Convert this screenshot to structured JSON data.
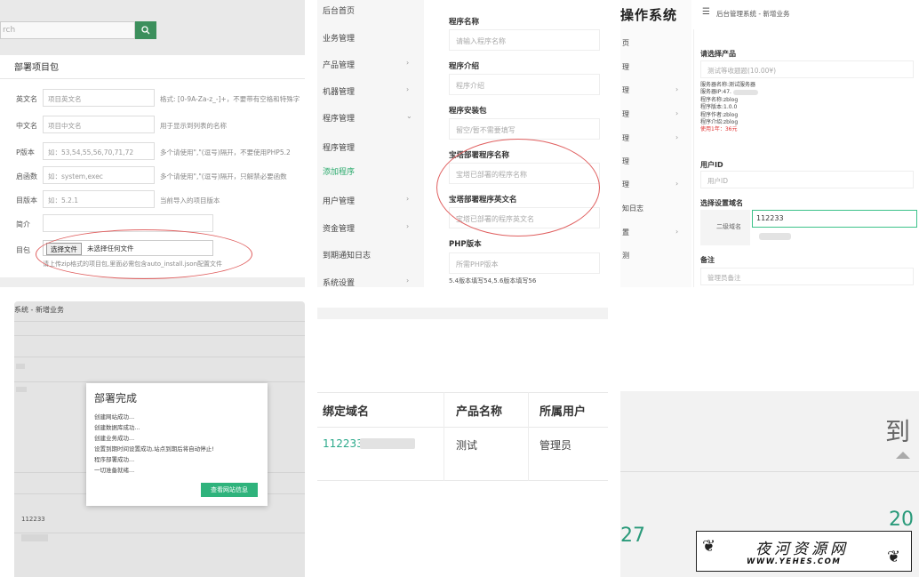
{
  "panel1": {
    "search_placeholder": "rch",
    "search_icon": "search-icon",
    "page_title": "部署项目包",
    "rows": [
      {
        "label": "英文名",
        "value": "项目英文名",
        "hint": "格式: [0-9A-Za-z_-]+，不要带有空格和特殊字"
      },
      {
        "label": "中文名",
        "value": "项目中文名",
        "hint": "用于显示到列表的名称"
      },
      {
        "label": "P版本",
        "value": "如：53,54,55,56,70,71,72",
        "hint": "多个请使用\",\"(逗号)隔开，不要使用PHP5.2"
      },
      {
        "label": "启函数",
        "value": "如：system,exec",
        "hint": "多个请使用\",\"(逗号)隔开，只解禁必要函数"
      },
      {
        "label": "目版本",
        "value": "如：5.2.1",
        "hint": "当前导入的项目版本"
      },
      {
        "label": "简介",
        "value": "",
        "hint": ""
      }
    ],
    "file_label": "目包",
    "file_button": "选择文件",
    "file_status": "未选择任何文件",
    "file_hint": "请上传zip格式的项目包,里面必需包含auto_install.json配置文件"
  },
  "panel2": {
    "nav": [
      {
        "label": "后台首页",
        "chev": false,
        "active": false
      },
      {
        "label": "业务管理",
        "chev": false,
        "active": false
      },
      {
        "label": "产品管理",
        "chev": true,
        "active": false
      },
      {
        "label": "机器管理",
        "chev": true,
        "active": false
      },
      {
        "label": "程序管理",
        "chev": true,
        "active": false
      },
      {
        "label": "程序管理",
        "chev": false,
        "active": false
      },
      {
        "label": "添加程序",
        "chev": false,
        "active": true
      },
      {
        "label": "用户管理",
        "chev": true,
        "active": false
      },
      {
        "label": "资金管理",
        "chev": true,
        "active": false
      },
      {
        "label": "到期通知日志",
        "chev": false,
        "active": false
      },
      {
        "label": "系统设置",
        "chev": true,
        "active": false
      }
    ],
    "fields": [
      {
        "label": "程序名称",
        "placeholder": "请输入程序名称"
      },
      {
        "label": "程序介绍",
        "placeholder": "程序介绍"
      },
      {
        "label": "程序安装包",
        "placeholder": "留空/暂不需要填写"
      },
      {
        "label": "宝塔部署程序名称",
        "placeholder": "宝塔已部署的程序名称"
      },
      {
        "label": "宝塔部署程序英文名",
        "placeholder": "宝塔已部署的程序英文名"
      },
      {
        "label": "PHP版本",
        "placeholder": "所需PHP版本"
      }
    ],
    "note": "5.4版本填写54,5.6版本填写56"
  },
  "panel3": {
    "brand": "操作系统",
    "menu_icon": "hamburger-icon",
    "breadcrumb": "后台管理系统 - 新增业务",
    "side_items": [
      "页",
      "理",
      "理",
      "理",
      "理",
      "理",
      "理",
      "知日志",
      "置",
      "测"
    ],
    "product_label": "请选择产品",
    "product_value": "测试等收题题(10.00¥)",
    "info": [
      "服务器名称:测试服务器",
      "服务器IP:47.",
      "程序名称:zblog",
      "程序版本:1.0.0",
      "程序作者:zblog",
      "程序介绍:zblog"
    ],
    "info_price": "使用1年：36元",
    "user_label": "用户ID",
    "user_placeholder": "用户ID",
    "domain_label": "选择设置域名",
    "subdomain_label": "二级域名",
    "domain_value": "112233",
    "note_label": "备注",
    "note_placeholder": "管理员备注"
  },
  "panel4": {
    "breadcrumb": "系统 - 新增业务",
    "dialog_title": "部署完成",
    "dialog_lines": [
      "创建网站成功...",
      "创建数据库成功...",
      "创建业务成功...",
      "设置到期时间设置成功,站点到期后将自动停止!",
      "程序部署成功...",
      "一切准备就绪..."
    ],
    "dialog_button": "查看网站信息",
    "row_value": "112233"
  },
  "panel5": {
    "headers": [
      "绑定域名",
      "产品名称",
      "所属用户"
    ],
    "row": [
      "112233.",
      "测试",
      "管理员"
    ]
  },
  "panel6": {
    "big_text": "到",
    "num_a": "27",
    "num_b": "20"
  },
  "watermark": {
    "cn": "夜河资源网",
    "en": "WWW.YEHES.COM"
  }
}
